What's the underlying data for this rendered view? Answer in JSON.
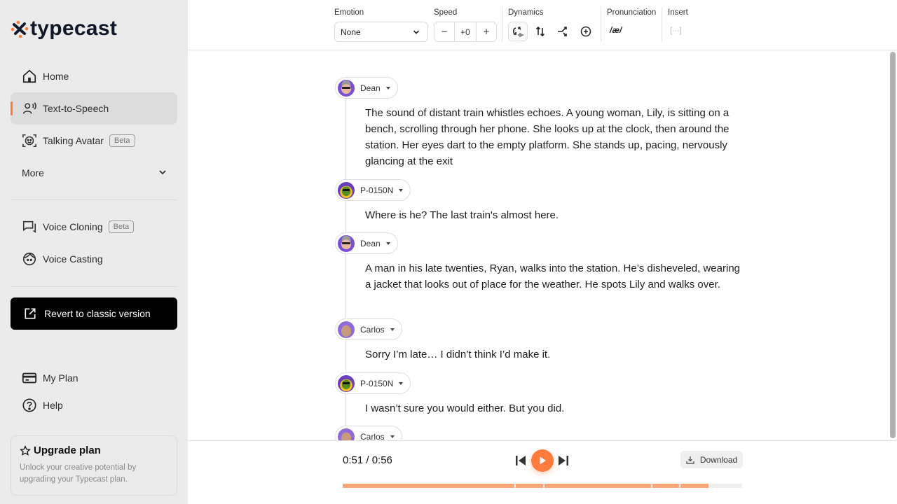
{
  "brand": {
    "name": "typecast",
    "accent": "#ff7a3d",
    "logo_dark": "#111827"
  },
  "sidebar": {
    "items": [
      {
        "label": "Home",
        "icon": "home-icon"
      },
      {
        "label": "Text-to-Speech",
        "icon": "speaker-person-icon",
        "active": true
      },
      {
        "label": "Talking Avatar",
        "icon": "face-scan-icon",
        "badge": "Beta"
      },
      {
        "label": "More",
        "icon": "chevron-down-icon"
      },
      {
        "label": "Voice Cloning",
        "icon": "chat-bubbles-icon",
        "badge": "Beta"
      },
      {
        "label": "Voice Casting",
        "icon": "face-icon"
      }
    ],
    "revert_label": "Revert to classic version",
    "bottom_items": [
      {
        "label": "My Plan",
        "icon": "credit-card-icon"
      },
      {
        "label": "Help",
        "icon": "help-circle-icon"
      }
    ],
    "upgrade": {
      "title": "Upgrade plan",
      "description": "Unlock your creative potential by upgrading your Typecast plan."
    }
  },
  "toolbar": {
    "emotion_label": "Emotion",
    "emotion_value": "None",
    "speed_label": "Speed",
    "speed_value": "+0",
    "speed_minus": "−",
    "speed_plus": "+",
    "dynamics_label": "Dynamics",
    "dynamics_buttons": [
      "intonation-icon",
      "pitch-icon",
      "transition-icon",
      "add-icon"
    ],
    "pronunciation_label": "Pronunciation",
    "pronunciation_symbol": "/æ/",
    "insert_label": "Insert",
    "insert_symbol": "[···]"
  },
  "script": [
    {
      "speaker": "Dean",
      "avatar": "dean",
      "text": "The sound of distant train whistles echoes. A young woman, Lily, is sitting on a bench, scrolling through her phone. She looks up at the clock, then around the station. Her eyes dart to the empty platform. She stands up, pacing, nervously glancing at the exit"
    },
    {
      "speaker": "P-0150N",
      "avatar": "p0150n",
      "text": "Where is he? The last train's almost here."
    },
    {
      "speaker": "Dean",
      "avatar": "dean",
      "text": "A man in his late twenties, Ryan, walks into the station. He’s disheveled, wearing a jacket that looks out of place for the weather. He spots Lily and walks over."
    },
    {
      "speaker": "Carlos",
      "avatar": "carlos",
      "text": "Sorry I’m late… I didn’t think I’d make it."
    },
    {
      "speaker": "P-0150N",
      "avatar": "p0150n",
      "text": "I wasn’t sure you would either. But you did."
    },
    {
      "speaker": "Carlos",
      "avatar": "carlos",
      "text": ""
    }
  ],
  "player": {
    "current_time": "0:51",
    "total_time": "0:56",
    "time_display": "0:51 / 0:56",
    "download_label": "Download",
    "progress_fraction": 0.915,
    "segments": [
      {
        "start": 0.0,
        "end": 0.43
      },
      {
        "start": 0.433,
        "end": 0.502
      },
      {
        "start": 0.505,
        "end": 0.772
      },
      {
        "start": 0.775,
        "end": 0.842
      },
      {
        "start": 0.845,
        "end": 0.915
      }
    ]
  }
}
